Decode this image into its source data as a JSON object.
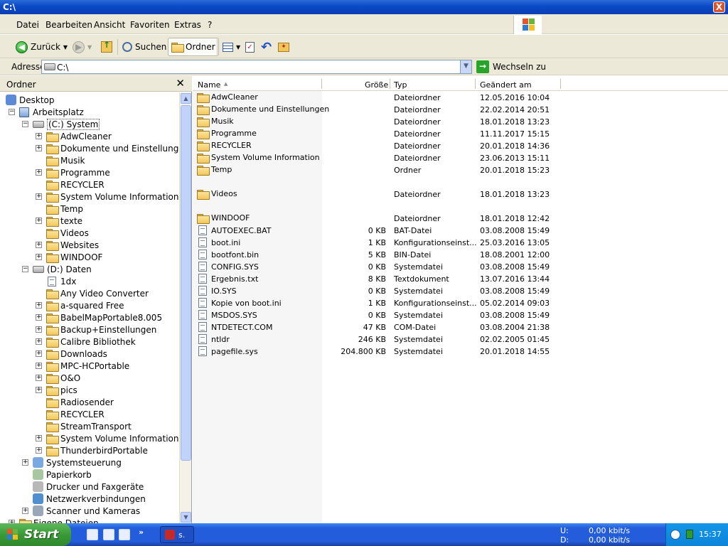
{
  "window": {
    "title": "C:\\",
    "close_glyph": "X"
  },
  "menu": [
    "Datei",
    "Bearbeiten",
    "Ansicht",
    "Favoriten",
    "Extras",
    "?"
  ],
  "toolbar": {
    "back_label": "Zurück",
    "search_label": "Suchen",
    "folders_label": "Ordner"
  },
  "address": {
    "label": "Adresse",
    "value": "C:\\",
    "go_label": "Wechseln zu"
  },
  "folder_pane": {
    "title": "Ordner",
    "close_glyph": "✕",
    "tree": [
      {
        "label": "Desktop",
        "level": 0,
        "icon": "desktop-icon"
      },
      {
        "label": "Arbeitsplatz",
        "level": 1,
        "expander": "−",
        "icon": "computer-icon"
      },
      {
        "label": "(C:) System",
        "level": 2,
        "expander": "−",
        "icon": "drive-icon",
        "selected": true
      },
      {
        "label": "AdwCleaner",
        "level": 3,
        "expander": "+",
        "icon": "folder-icon"
      },
      {
        "label": "Dokumente und Einstellungen",
        "level": 3,
        "expander": "+",
        "icon": "folder-icon"
      },
      {
        "label": "Musik",
        "level": 3,
        "icon": "folder-icon"
      },
      {
        "label": "Programme",
        "level": 3,
        "expander": "+",
        "icon": "folder-icon"
      },
      {
        "label": "RECYCLER",
        "level": 3,
        "icon": "folder-icon"
      },
      {
        "label": "System Volume Information",
        "level": 3,
        "expander": "+",
        "icon": "folder-icon"
      },
      {
        "label": "Temp",
        "level": 3,
        "icon": "folder-icon"
      },
      {
        "label": "texte",
        "level": 3,
        "expander": "+",
        "icon": "folder-icon"
      },
      {
        "label": "Videos",
        "level": 3,
        "icon": "folder-icon"
      },
      {
        "label": "Websites",
        "level": 3,
        "expander": "+",
        "icon": "folder-icon"
      },
      {
        "label": "WINDOOF",
        "level": 3,
        "expander": "+",
        "icon": "folder-icon"
      },
      {
        "label": "(D:) Daten",
        "level": 2,
        "expander": "−",
        "icon": "drive-icon"
      },
      {
        "label": "1dx",
        "level": 3,
        "icon": "file-icon"
      },
      {
        "label": "Any Video Converter",
        "level": 3,
        "icon": "folder-icon"
      },
      {
        "label": "a-squared Free",
        "level": 3,
        "expander": "+",
        "icon": "folder-icon"
      },
      {
        "label": "BabelMapPortable8.005",
        "level": 3,
        "expander": "+",
        "icon": "folder-icon"
      },
      {
        "label": "Backup+Einstellungen",
        "level": 3,
        "expander": "+",
        "icon": "folder-icon"
      },
      {
        "label": "Calibre Bibliothek",
        "level": 3,
        "expander": "+",
        "icon": "folder-icon"
      },
      {
        "label": "Downloads",
        "level": 3,
        "expander": "+",
        "icon": "folder-icon"
      },
      {
        "label": "MPC-HCPortable",
        "level": 3,
        "expander": "+",
        "icon": "folder-icon"
      },
      {
        "label": "O&O",
        "level": 3,
        "expander": "+",
        "icon": "folder-icon"
      },
      {
        "label": "pics",
        "level": 3,
        "expander": "+",
        "icon": "folder-icon"
      },
      {
        "label": "Radiosender",
        "level": 3,
        "icon": "folder-icon"
      },
      {
        "label": "RECYCLER",
        "level": 3,
        "icon": "folder-icon"
      },
      {
        "label": "StreamTransport",
        "level": 3,
        "icon": "folder-icon"
      },
      {
        "label": "System Volume Information",
        "level": 3,
        "expander": "+",
        "icon": "folder-icon"
      },
      {
        "label": "ThunderbirdPortable",
        "level": 3,
        "expander": "+",
        "icon": "folder-icon"
      },
      {
        "label": "Systemsteuerung",
        "level": 2,
        "expander": "+",
        "icon": "control-panel-icon"
      },
      {
        "label": "Papierkorb",
        "level": 2,
        "icon": "recycle-bin-icon"
      },
      {
        "label": "Drucker und Faxgeräte",
        "level": 2,
        "icon": "printer-icon"
      },
      {
        "label": "Netzwerkverbindungen",
        "level": 2,
        "icon": "network-icon"
      },
      {
        "label": "Scanner und Kameras",
        "level": 2,
        "expander": "+",
        "icon": "scanner-icon"
      },
      {
        "label": "Eigene Dateien",
        "level": 1,
        "expander": "+",
        "icon": "folder-icon"
      }
    ]
  },
  "file_list": {
    "columns": {
      "name": "Name",
      "size": "Größe",
      "type": "Typ",
      "modified": "Geändert am"
    },
    "rows": [
      {
        "name": "AdwCleaner",
        "size": "",
        "type": "Dateiordner",
        "modified": "12.05.2016 10:04",
        "icon": "folder-icon"
      },
      {
        "name": "Dokumente und Einstellungen",
        "size": "",
        "type": "Dateiordner",
        "modified": "22.02.2014 20:51",
        "icon": "folder-icon"
      },
      {
        "name": "Musik",
        "size": "",
        "type": "Dateiordner",
        "modified": "18.01.2018 13:23",
        "icon": "folder-icon"
      },
      {
        "name": "Programme",
        "size": "",
        "type": "Dateiordner",
        "modified": "11.11.2017 15:15",
        "icon": "folder-icon"
      },
      {
        "name": "RECYCLER",
        "size": "",
        "type": "Dateiordner",
        "modified": "20.01.2018 14:36",
        "icon": "folder-icon"
      },
      {
        "name": "System Volume Information",
        "size": "",
        "type": "Dateiordner",
        "modified": "23.06.2013 15:11",
        "icon": "folder-icon"
      },
      {
        "name": "Temp",
        "size": "",
        "type": "Ordner",
        "modified": "20.01.2018 15:23",
        "icon": "folder-icon"
      },
      {
        "name": "",
        "size": "",
        "type": "",
        "modified": "",
        "icon": ""
      },
      {
        "name": "Videos",
        "size": "",
        "type": "Dateiordner",
        "modified": "18.01.2018 13:23",
        "icon": "folder-icon"
      },
      {
        "name": "",
        "size": "",
        "type": "",
        "modified": "",
        "icon": ""
      },
      {
        "name": "WINDOOF",
        "size": "",
        "type": "Dateiordner",
        "modified": "18.01.2018 12:42",
        "icon": "folder-icon"
      },
      {
        "name": "AUTOEXEC.BAT",
        "size": "0 KB",
        "type": "BAT-Datei",
        "modified": "03.08.2008 15:49",
        "icon": "file-icon"
      },
      {
        "name": "boot.ini",
        "size": "1 KB",
        "type": "Konfigurationseinst...",
        "modified": "25.03.2016 13:05",
        "icon": "file-icon"
      },
      {
        "name": "bootfont.bin",
        "size": "5 KB",
        "type": "BIN-Datei",
        "modified": "18.08.2001 12:00",
        "icon": "file-icon"
      },
      {
        "name": "CONFIG.SYS",
        "size": "0 KB",
        "type": "Systemdatei",
        "modified": "03.08.2008 15:49",
        "icon": "file-icon"
      },
      {
        "name": "Ergebnis.txt",
        "size": "8 KB",
        "type": "Textdokument",
        "modified": "13.07.2016 13:44",
        "icon": "file-icon"
      },
      {
        "name": "IO.SYS",
        "size": "0 KB",
        "type": "Systemdatei",
        "modified": "03.08.2008 15:49",
        "icon": "file-icon"
      },
      {
        "name": "Kopie von boot.ini",
        "size": "1 KB",
        "type": "Konfigurationseinst...",
        "modified": "05.02.2014 09:03",
        "icon": "file-icon"
      },
      {
        "name": "MSDOS.SYS",
        "size": "0 KB",
        "type": "Systemdatei",
        "modified": "03.08.2008 15:49",
        "icon": "file-icon"
      },
      {
        "name": "NTDETECT.COM",
        "size": "47 KB",
        "type": "COM-Datei",
        "modified": "03.08.2004 21:38",
        "icon": "file-icon"
      },
      {
        "name": "ntldr",
        "size": "246 KB",
        "type": "Systemdatei",
        "modified": "02.02.2005 01:45",
        "icon": "file-icon"
      },
      {
        "name": "pagefile.sys",
        "size": "204.800 KB",
        "type": "Systemdatei",
        "modified": "20.01.2018 14:55",
        "icon": "file-icon"
      }
    ]
  },
  "taskbar": {
    "start_label": "Start",
    "task_label": "s.",
    "net": {
      "up_label": "U:",
      "down_label": "D:",
      "up_value": "0,00 kbit/s",
      "down_value": "0,00 kbit/s"
    },
    "clock": "15:37"
  },
  "colors": {
    "titlebar": "#0a49c6",
    "chrome": "#ece9d8",
    "taskbar": "#245ddb",
    "start": "#3a9a37"
  }
}
